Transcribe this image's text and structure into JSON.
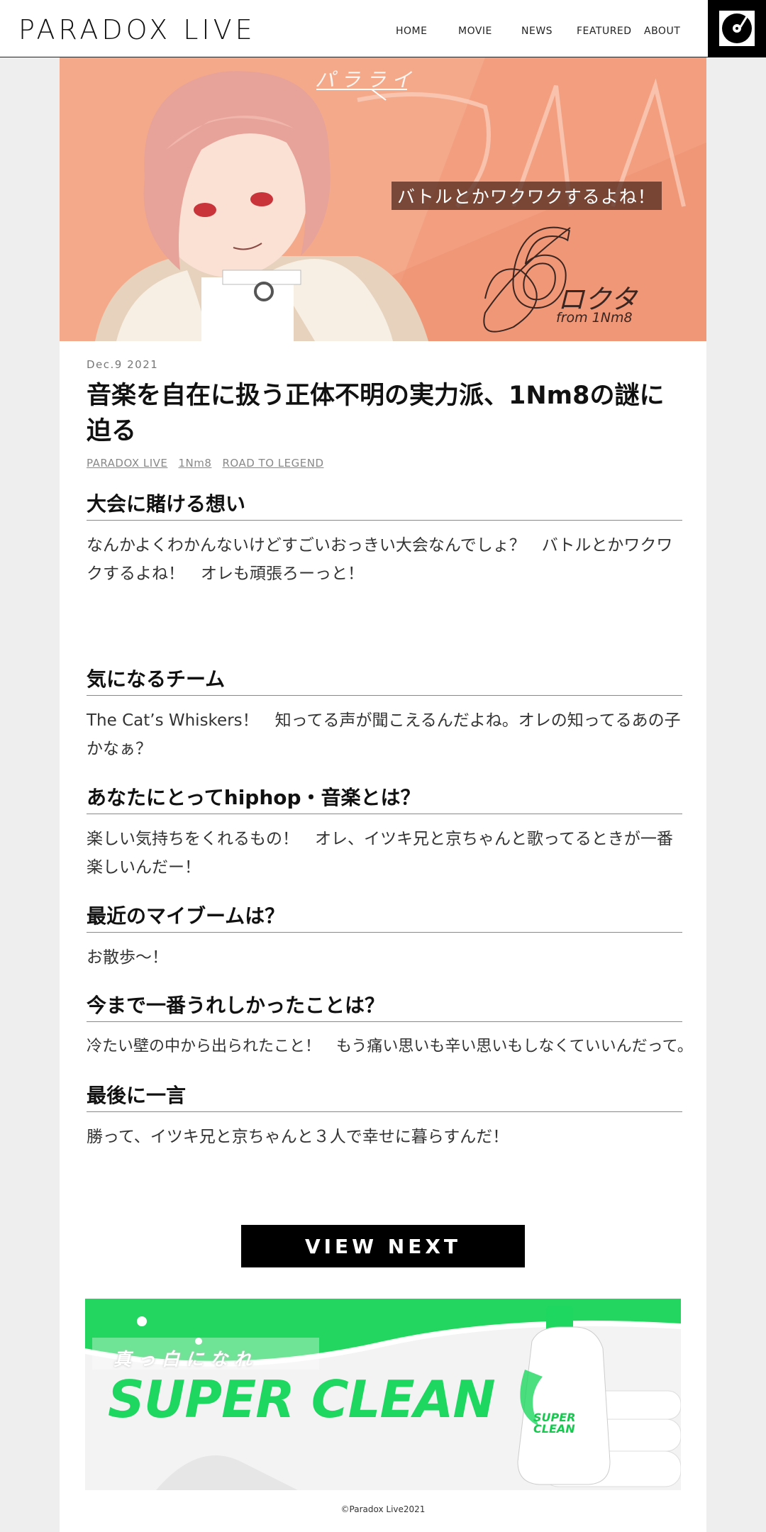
{
  "header": {
    "logo": "PARADOX LIVE",
    "nav": [
      "HOME",
      "MOVIE",
      "NEWS",
      "FEATURED",
      "ABOUT"
    ]
  },
  "hero": {
    "subtitle": "パラライ",
    "quote": "バトルとかワクワクするよね！",
    "number": "6",
    "name": "ロクタ",
    "team": "from 1Nm8"
  },
  "article": {
    "date": "Dec.9 2021",
    "title": "音楽を自在に扱う正体不明の実力派、1Nm8の謎に迫る",
    "tags": [
      "PARADOX LIVE",
      "1Nm8",
      "ROAD TO LEGEND"
    ],
    "qa": [
      {
        "q": "大会に賭ける想い",
        "a": "なんかよくわかんないけどすごいおっきい大会なんでしょ？　バトルとかワクワクするよね！　オレも頑張ろーっと！"
      },
      {
        "q": "気になるチーム",
        "a": "The Cat’s Whiskers！　知ってる声が聞こえるんだよね。オレの知ってるあの子かなぁ？"
      },
      {
        "q": "あなたにとってhiphop・音楽とは？",
        "a": "楽しい気持ちをくれるもの！　オレ、イツキ兄と京ちゃんと歌ってるときが一番楽しいんだー！"
      },
      {
        "q": "最近のマイブームは？",
        "a": "お散歩〜！"
      },
      {
        "q": "今まで一番うれしかったことは？",
        "a": "冷たい壁の中から出られたこと！　もう痛い思いも辛い思いもしなくていいんだって。"
      },
      {
        "q": "最後に一言",
        "a": "勝って、イツキ兄と京ちゃんと３人で幸せに暮らすんだ！"
      }
    ]
  },
  "view_next": "VIEW NEXT",
  "banner": {
    "tagline": "真っ白になれ",
    "title": "SUPER CLEAN",
    "bottle_text": "SUPER CLEAN"
  },
  "footer": {
    "copyright": "©Paradox Live2021"
  },
  "colors": {
    "hero_bg": "#f4a98a",
    "banner_green": "#1ed760"
  }
}
